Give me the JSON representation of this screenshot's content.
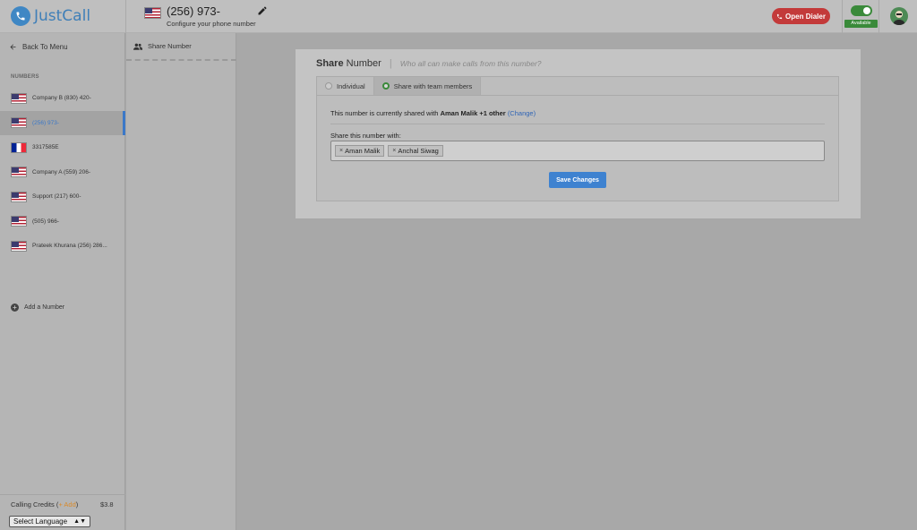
{
  "app": {
    "logo_text": "JustCall"
  },
  "header": {
    "number": "(256) 973-",
    "subtitle": "Configure your phone number",
    "open_dialer_label": "Open Dialer",
    "status_label": "Available"
  },
  "sidebar": {
    "back_label": "Back To Menu",
    "section_label": "NUMBERS",
    "numbers": [
      {
        "label": "Company B   (830) 420-",
        "flag": "us",
        "active": false
      },
      {
        "label": "(256) 973-",
        "flag": "us",
        "active": true
      },
      {
        "label": "3317585E",
        "flag": "fr",
        "active": false
      },
      {
        "label": "Company A   (559) 206-",
        "flag": "us",
        "active": false
      },
      {
        "label": "Support   (217) 600-",
        "flag": "us",
        "active": false
      },
      {
        "label": "(505) 966-",
        "flag": "us",
        "active": false
      },
      {
        "label": "Prateek Khurana   (256) 286...",
        "flag": "us",
        "active": false
      }
    ],
    "add_number_label": "Add a Number",
    "credits_label": "Calling Credits",
    "credits_add": "+ Add",
    "credits_value": "$3.8",
    "language_selected": "Select Language"
  },
  "subpanel": {
    "item_label": "Share Number"
  },
  "card": {
    "title_bold": "Share",
    "title_rest": "Number",
    "separator": "|",
    "hint": "Who all can make calls from this number?",
    "tabs": [
      {
        "label": "Individual",
        "selected": false
      },
      {
        "label": "Share with team members",
        "selected": true
      }
    ],
    "shared_text": "This number is currently shared with",
    "shared_with": "Aman Malik +1 other",
    "change_link": "(Change)",
    "share_label": "Share this number with:",
    "tags": [
      "Aman Malik",
      "Anchal Siwag"
    ],
    "save_label": "Save Changes"
  }
}
